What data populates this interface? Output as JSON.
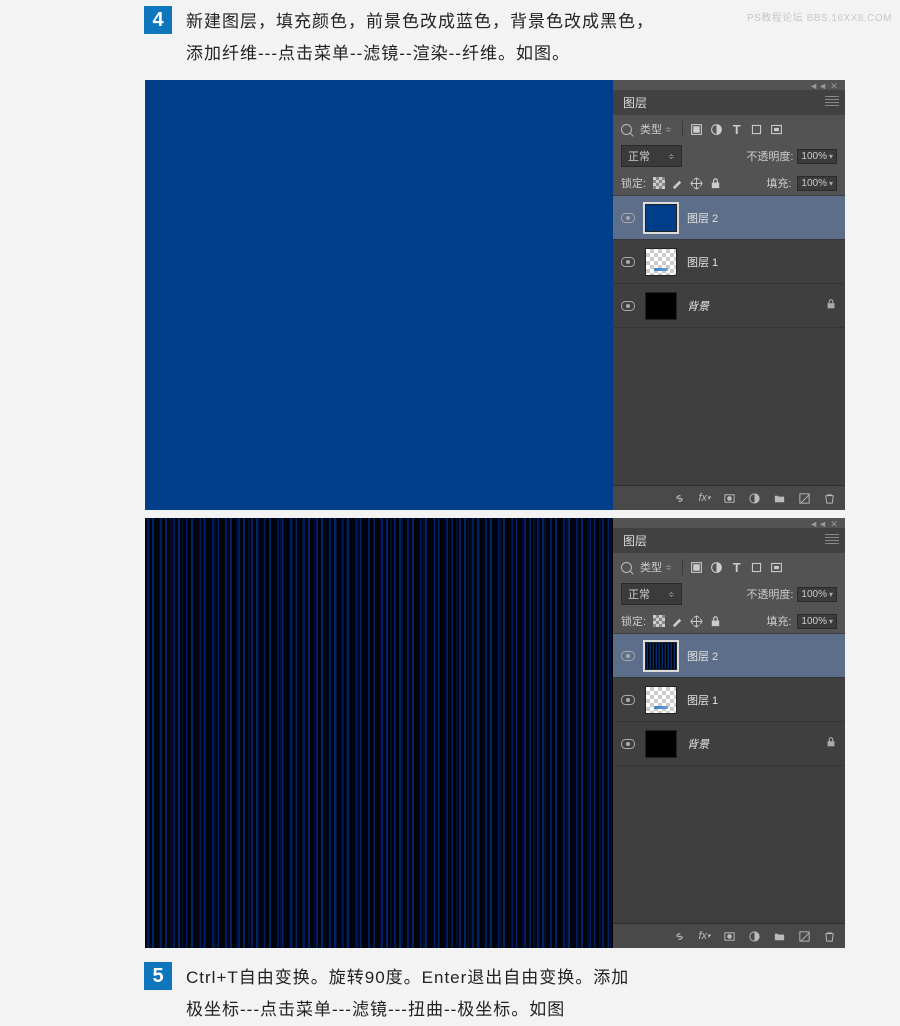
{
  "watermark": "PS教程论坛  BBS.16XX8.COM",
  "step4": {
    "num": "4",
    "line1": "新建图层，填充颜色，前景色改成蓝色，背景色改成黑色，",
    "line2": "添加纤维---点击菜单--滤镜--渲染--纤维。如图。"
  },
  "step5": {
    "num": "5",
    "line1": "Ctrl+T自由变换。旋转90度。Enter退出自由变换。添加",
    "line2": "极坐标---点击菜单---滤镜---扭曲--极坐标。如图"
  },
  "panel": {
    "title": "图层",
    "type_label": "类型",
    "blend_mode": "正常",
    "opacity_label": "不透明度:",
    "opacity_value": "100%",
    "lock_label": "锁定:",
    "fill_label": "填充:",
    "fill_value": "100%",
    "fx_label": "fx",
    "layers": [
      {
        "name": "图层 2"
      },
      {
        "name": "图层 1"
      },
      {
        "name": "背景"
      }
    ]
  }
}
